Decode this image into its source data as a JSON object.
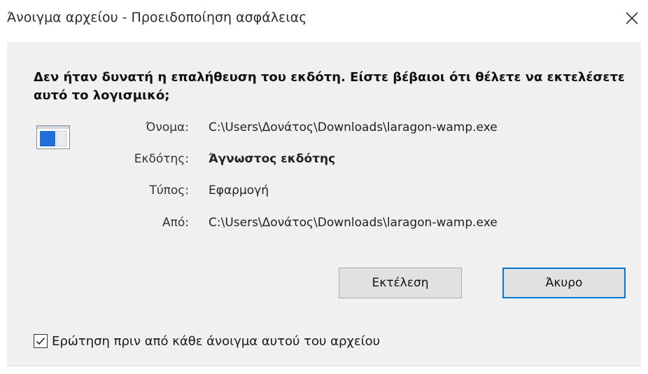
{
  "window": {
    "title": "Άνοιγμα αρχείου - Προειδοποίηση ασφάλειας",
    "close_glyph": "✕"
  },
  "message": {
    "warning": "Δεν ήταν δυνατή η επαλήθευση του εκδότη. Είστε βέβαιοι ότι θέλετε να εκτελέσετε αυτό το λογισμικό;"
  },
  "file_icon": "application-window-icon",
  "details": [
    {
      "label": "Όνομα:",
      "value": "C:\\Users\\Δονάτος\\Downloads\\laragon-wamp.exe"
    },
    {
      "label": "Εκδότης:",
      "value": "Άγνωστος εκδότης"
    },
    {
      "label": "Τύπος:",
      "value": "Εφαρμογή"
    },
    {
      "label": "Από:",
      "value": "C:\\Users\\Δονάτος\\Downloads\\laragon-wamp.exe"
    }
  ],
  "buttons": {
    "run": "Εκτέλεση",
    "cancel": "Άκυρο"
  },
  "checkbox": {
    "label": "Ερώτηση πριν από κάθε άνοιγμα αυτού του αρχείου",
    "checked": true
  },
  "colors": {
    "accent": "#0078d7",
    "background": "#f0f0f0"
  }
}
